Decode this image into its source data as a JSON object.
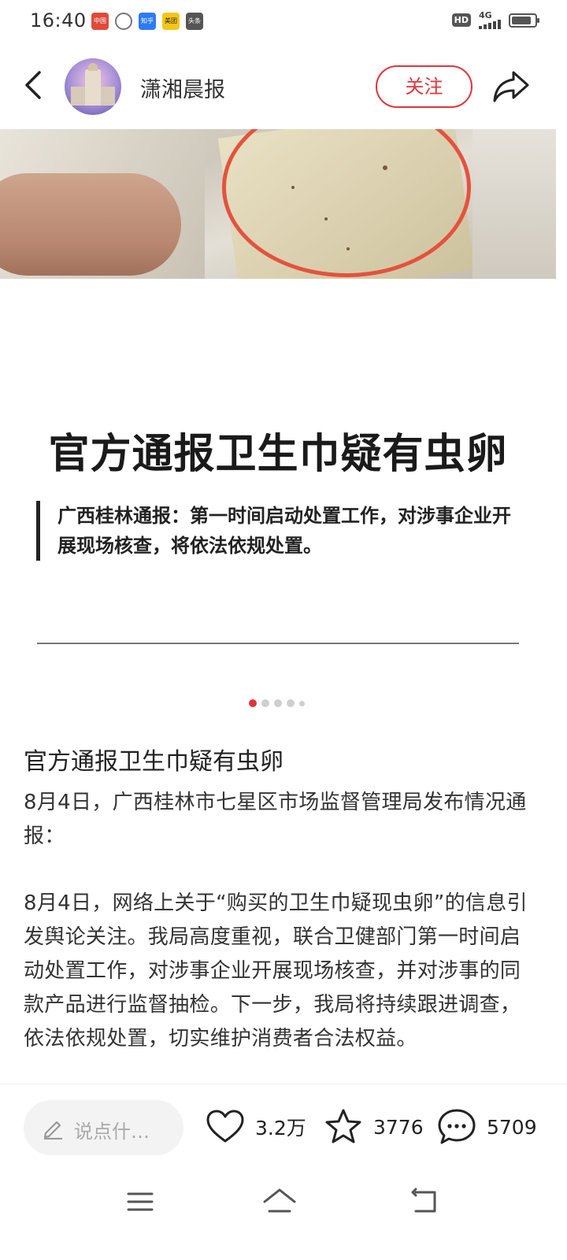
{
  "status_bar": {
    "time": "16:40",
    "apps": [
      {
        "icon": "news-app-icon",
        "label": "中国",
        "color": "#e04a3a"
      },
      {
        "icon": "circle-app-icon",
        "label": "",
        "color": "#777777"
      },
      {
        "icon": "zhihu-icon",
        "label": "知乎",
        "color": "#2d7bf4"
      },
      {
        "icon": "meituan-icon",
        "label": "美团",
        "color": "#f5c518"
      },
      {
        "icon": "toutiao-icon",
        "label": "头条",
        "color": "#555555"
      }
    ],
    "hd": "HD",
    "network": "4G",
    "battery_level": 0.85
  },
  "header": {
    "account_name": "潇湘晨报",
    "follow_label": "关注"
  },
  "slide": {
    "headline": "官方通报卫生巾疑有虫卵",
    "quote": "广西桂林通报：第一时间启动处置工作，对涉事企业开展现场核查，将依法依规处置。",
    "pager_total": 5,
    "pager_active": 0
  },
  "article": {
    "title": "官方通报卫生巾疑有虫卵",
    "paragraphs": [
      "8月4日，广西桂林市七星区市场监督管理局发布情况通报：",
      "8月4日，网络上关于“购买的卫生巾疑现虫卵”的信息引发舆论关注。我局高度重视，联合卫健部门第一时间启动处置工作，对涉事企业开展现场核查，并对涉事的同款产品进行监督抽检。下一步，我局将持续跟进调查，依法依规处置，切实维护消费者合法权益。"
    ]
  },
  "actions": {
    "comment_placeholder": "说点什…",
    "likes": "3.2万",
    "favorites": "3776",
    "comments": "5709"
  },
  "colors": {
    "accent": "#e0343c"
  }
}
